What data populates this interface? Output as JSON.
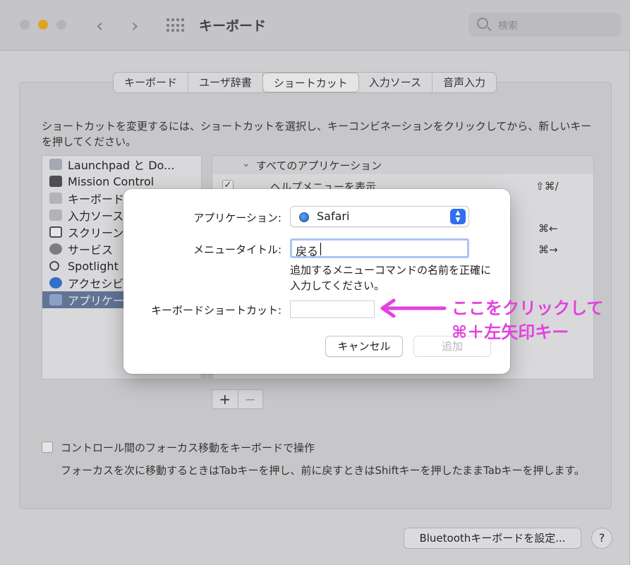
{
  "window": {
    "title": "キーボード",
    "search_placeholder": "検索",
    "traffic_lights": [
      "#c9c9cc",
      "#f6b726",
      "#c9c9cc"
    ]
  },
  "tabs": [
    {
      "label": "キーボード",
      "selected": false
    },
    {
      "label": "ユーザ辞書",
      "selected": false
    },
    {
      "label": "ショートカット",
      "selected": true
    },
    {
      "label": "入力ソース",
      "selected": false
    },
    {
      "label": "音声入力",
      "selected": false
    }
  ],
  "description": "ショートカットを変更するには、ショートカットを選択し、キーコンビネーションをクリックしてから、新しいキーを押してください。",
  "sidebar": {
    "items": [
      {
        "label": "Launchpad と Do...",
        "icon": "launchpad-icon",
        "selected": false
      },
      {
        "label": "Mission Control",
        "icon": "mission-control-icon",
        "selected": false
      },
      {
        "label": "キーボード",
        "icon": "keyboard-icon",
        "selected": false
      },
      {
        "label": "入力ソース",
        "icon": "input-source-icon",
        "selected": false
      },
      {
        "label": "スクリーン",
        "icon": "screenshot-icon",
        "selected": false
      },
      {
        "label": "サービス",
        "icon": "services-gear-icon",
        "selected": false
      },
      {
        "label": "Spotlight",
        "icon": "spotlight-icon",
        "selected": false
      },
      {
        "label": "アクセシビ",
        "icon": "accessibility-icon",
        "selected": false
      },
      {
        "label": "アプリケー",
        "icon": "app-shortcuts-icon",
        "selected": true
      }
    ]
  },
  "shortcuts": {
    "group_label": "すべてのアプリケーション",
    "rows": [
      {
        "label": "ヘルプメニューを表示",
        "keys": "⇧⌘/",
        "checked": true
      }
    ],
    "visible_keys": [
      "⌘←",
      "⌘→"
    ]
  },
  "plus_label": "+",
  "minus_label": "−",
  "focus_option": {
    "label": "コントロール間のフォーカス移動をキーボードで操作",
    "hint": "フォーカスを次に移動するときはTabキーを押し、前に戻すときはShiftキーを押したままTabキーを押します。"
  },
  "bluetooth_button": "Bluetoothキーボードを設定...",
  "help_button": "?",
  "dialog": {
    "app_label": "アプリケーション:",
    "app_value": "Safari",
    "menu_title_label": "メニュータイトル:",
    "menu_title_value": "戻る",
    "note": "追加するメニューコマンドの名前を正確に入力してください。",
    "shortcut_label": "キーボードショートカット:",
    "shortcut_value": "",
    "cancel_label": "キャンセル",
    "add_label": "追加"
  },
  "annotation": {
    "line1": "ここをクリックして",
    "line2": "⌘＋左矢印キー",
    "color": "#e342e0"
  }
}
